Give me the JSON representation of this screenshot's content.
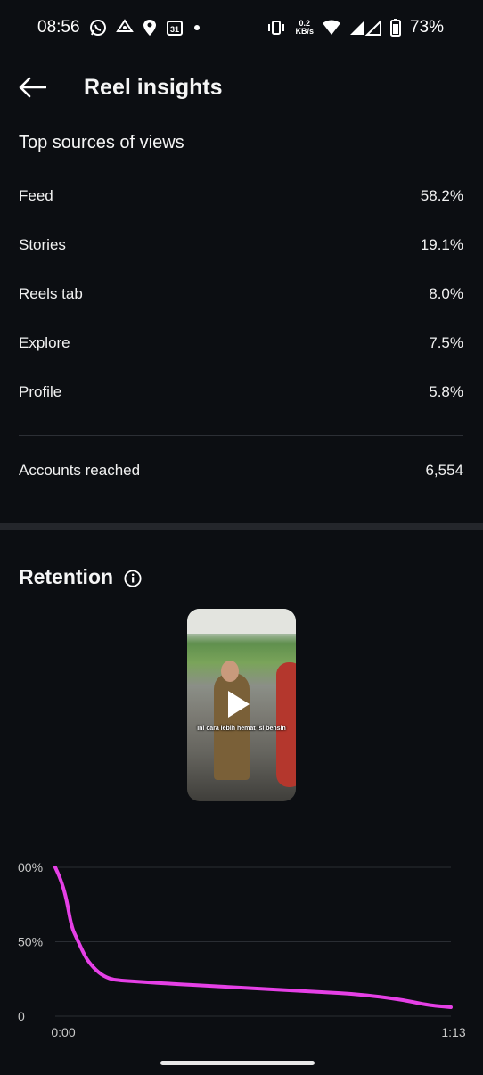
{
  "status_bar": {
    "time": "08:56",
    "net_speed_value": "0.2",
    "net_speed_unit": "KB/s",
    "battery": "73%",
    "calendar_day": "31",
    "icons": [
      "whatsapp-icon",
      "mobile-app-icon",
      "location-pin-icon",
      "calendar-icon",
      "dot-icon",
      "vibrate-icon",
      "wifi-icon",
      "signal-icon",
      "battery-icon"
    ]
  },
  "header": {
    "title": "Reel insights",
    "back_icon": "arrow-left-icon"
  },
  "top_sources": {
    "title": "Top sources of views",
    "rows": [
      {
        "label": "Feed",
        "value": "58.2%"
      },
      {
        "label": "Stories",
        "value": "19.1%"
      },
      {
        "label": "Reels tab",
        "value": "8.0%"
      },
      {
        "label": "Explore",
        "value": "7.5%"
      },
      {
        "label": "Profile",
        "value": "5.8%"
      }
    ]
  },
  "accounts_reached": {
    "label": "Accounts reached",
    "value": "6,554"
  },
  "retention": {
    "title": "Retention",
    "info_icon": "info-icon",
    "thumbnail_caption": "Ini cara lebih hemat isi bensin",
    "accent_color": "#e640e6"
  },
  "chart_data": {
    "type": "line",
    "y_tick_labels": [
      "00%",
      "50%",
      "0"
    ],
    "x_tick_labels": [
      "0:00",
      "1:13"
    ],
    "ylim": [
      0,
      100
    ],
    "xlim": [
      0,
      73
    ],
    "grid": true,
    "series": [
      {
        "color": "#e640e6",
        "x": [
          0,
          1,
          2,
          3,
          4,
          5,
          6,
          8,
          10,
          12,
          16,
          20,
          30,
          40,
          50,
          55,
          60,
          64,
          68,
          70,
          73
        ],
        "y": [
          100,
          92,
          80,
          60,
          52,
          44,
          37,
          29,
          25,
          24,
          23,
          22,
          20,
          18,
          16,
          15,
          13,
          11,
          8,
          7,
          6
        ]
      }
    ]
  }
}
